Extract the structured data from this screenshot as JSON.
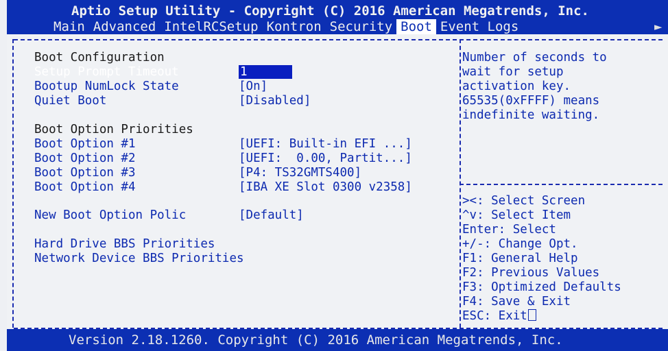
{
  "header": {
    "title": "Aptio Setup Utility - Copyright (C) 2016 American Megatrends, Inc.",
    "menu": [
      "Main",
      "Advanced",
      "IntelRCSetup",
      "Kontron",
      "Security",
      "Boot",
      "Event Logs"
    ],
    "active_tab": "Boot",
    "more_arrow": "►"
  },
  "settings": {
    "boot_config_heading": "Boot Configuration",
    "setup_prompt_timeout": {
      "label": "Setup Prompt Timeout",
      "value": "1"
    },
    "bootup_numlock": {
      "label": "Bootup NumLock State",
      "value": "[On]"
    },
    "quiet_boot": {
      "label": "Quiet Boot",
      "value": "[Disabled]"
    },
    "priorities_heading": "Boot Option Priorities",
    "boot_options": [
      {
        "label": "Boot Option #1",
        "value": "[UEFI: Built-in EFI ...]"
      },
      {
        "label": "Boot Option #2",
        "value": "[UEFI:  0.00, Partit...]"
      },
      {
        "label": "Boot Option #3",
        "value": "[P4: TS32GMTS400]"
      },
      {
        "label": "Boot Option #4",
        "value": "[IBA XE Slot 0300 v2358]"
      }
    ],
    "new_boot_option": {
      "label": "New Boot Option Polic",
      "value": "[Default]"
    },
    "hdd_bbs": "Hard Drive BBS Priorities",
    "net_bbs": "Network Device BBS Priorities"
  },
  "help": {
    "description": [
      "Number of seconds to",
      "wait for setup",
      "activation key.",
      "65535(0xFFFF) means",
      "indefinite waiting."
    ],
    "keys": [
      "><: Select Screen",
      "^v: Select Item",
      "Enter: Select",
      "+/-: Change Opt.",
      "F1: General Help",
      "F2: Previous Values",
      "F3: Optimized Defaults",
      "F4: Save & Exit",
      "ESC: Exit"
    ]
  },
  "footer": {
    "text": "Version 2.18.1260. Copyright (C) 2016 American Megatrends, Inc."
  }
}
